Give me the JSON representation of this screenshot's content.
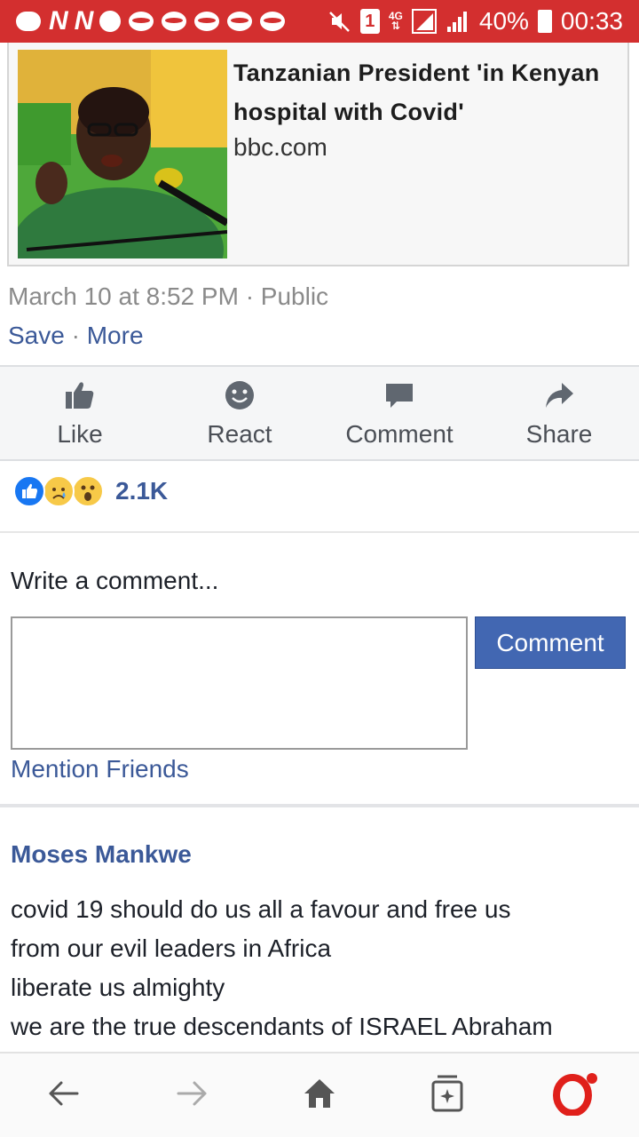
{
  "status_bar": {
    "battery": "40%",
    "time": "00:33",
    "sim_badge": "1",
    "network_type": "4G",
    "notification_letters": [
      "N",
      "N"
    ]
  },
  "link_card": {
    "title": "Tanzanian President 'in Kenyan hospital with Covid'",
    "domain": "bbc.com"
  },
  "post_meta": {
    "timestamp": "March 10 at 8:52 PM",
    "separator": "·",
    "audience": "Public"
  },
  "post_links": {
    "save": "Save",
    "separator": "·",
    "more": "More"
  },
  "action_bar": {
    "like": "Like",
    "react": "React",
    "comment": "Comment",
    "share": "Share"
  },
  "reactions": {
    "count": "2.1K",
    "types": [
      "like",
      "sad",
      "wow"
    ]
  },
  "comment_form": {
    "label": "Write a comment...",
    "input_value": "",
    "submit_label": "Comment",
    "mention_label": "Mention Friends"
  },
  "comment": {
    "author": "Moses Mankwe",
    "lines": [
      "covid 19 should do us all a favour and free us",
      "from our evil leaders in Africa",
      "liberate us almighty",
      "we are the true descendants of ISRAEL Abraham"
    ]
  },
  "colors": {
    "status_bar": "#d32f2f",
    "link_blue": "#3b5998",
    "button_blue": "#4267b2",
    "opera_red": "#e0201b"
  },
  "icons": [
    "back-arrow-icon",
    "forward-arrow-icon",
    "home-icon",
    "tabs-icon",
    "opera-icon"
  ]
}
